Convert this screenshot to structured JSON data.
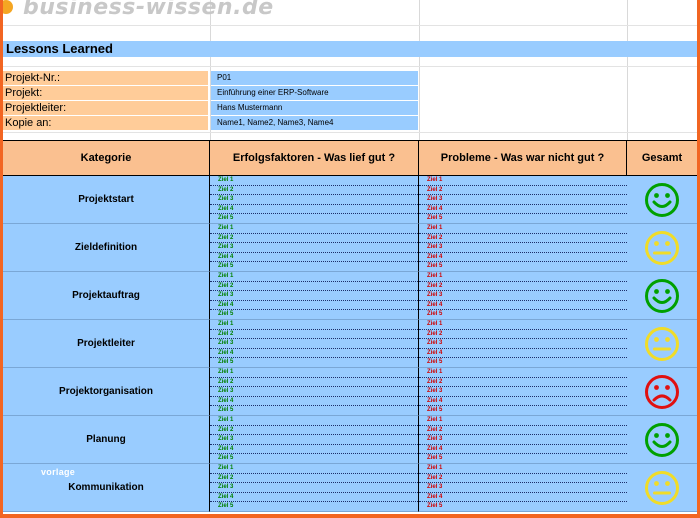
{
  "logo": {
    "text": "business-wissen.de"
  },
  "title": "Lessons Learned",
  "info": [
    {
      "label": "Projekt-Nr.:",
      "value": "P01"
    },
    {
      "label": "Projekt:",
      "value": "Einführung einer ERP-Software"
    },
    {
      "label": "Projektleiter:",
      "value": "Hans Mustermann"
    },
    {
      "label": "Kopie an:",
      "value": "Name1, Name2, Name3, Name4"
    }
  ],
  "table": {
    "headers": {
      "kategorie": "Kategorie",
      "erfolg": "Erfolgsfaktoren - Was lief gut ?",
      "probleme": "Probleme - Was war nicht gut ?",
      "gesamt": "Gesamt"
    },
    "goals": [
      "Ziel 1",
      "Ziel 2",
      "Ziel 3",
      "Ziel 4",
      "Ziel 5"
    ],
    "rows": [
      {
        "category": "Projektstart",
        "rating": "happy"
      },
      {
        "category": "Zieldefinition",
        "rating": "neutral"
      },
      {
        "category": "Projektauftrag",
        "rating": "happy"
      },
      {
        "category": "Projektleiter",
        "rating": "neutral"
      },
      {
        "category": "Projektorganisation",
        "rating": "sad"
      },
      {
        "category": "Planung",
        "rating": "happy"
      },
      {
        "category": "Kommunikation",
        "rating": "neutral"
      }
    ]
  },
  "colors": {
    "happy": "#00a000",
    "neutral": "#f0dc28",
    "sad": "#e01010",
    "header_fill": "#fac090",
    "row_fill": "#99ccff"
  },
  "watermark": "vorlage"
}
